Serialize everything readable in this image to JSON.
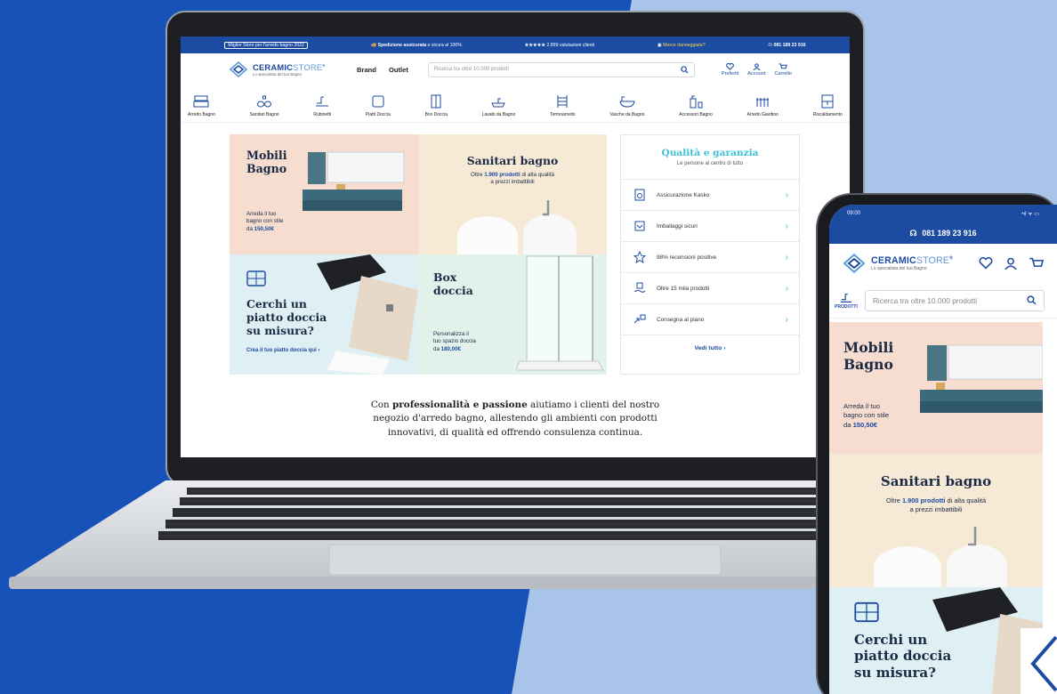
{
  "colors": {
    "brand_blue": "#1c4ba2",
    "accent_teal": "#3bc0d8",
    "bg_dark": "#1752b8",
    "bg_light": "#a8c4e8"
  },
  "topbar": {
    "best_store": "Miglior Store per l'arredo bagno 2022",
    "shipping_bold": "Spedizione assicurata",
    "shipping_rest": "e sicura al 100%",
    "stars": "★★★★★",
    "reviews": "2.899 valutazioni clienti",
    "damaged": "Merce danneggiata?",
    "phone": "081 189 23 916"
  },
  "header": {
    "brand_main": "CERAMIC",
    "brand_thin": "STORE",
    "brand_mark": "®",
    "tagline": "Lo specialista del tuo Bagno",
    "nav": [
      "Brand",
      "Outlet"
    ],
    "search_placeholder": "Ricerca tra oltre 10.000 prodotti",
    "icons": {
      "favorites": "Preferiti",
      "account": "Account",
      "cart": "Carrello"
    }
  },
  "categories": [
    "Arredo Bagno",
    "Sanitari Bagno",
    "Rubinetti",
    "Piatti Doccia",
    "Box Doccia",
    "Lavabi da Bagno",
    "Termoarredo",
    "Vasche da Bagno",
    "Accessori Bagno",
    "Arredo Giardino",
    "Riscaldamento"
  ],
  "tiles": {
    "mobili": {
      "title_1": "Mobili",
      "title_2": "Bagno",
      "text_1": "Arreda il tuo",
      "text_2": "bagno con stile",
      "text_3": "da",
      "price": "150,50€"
    },
    "sanitari": {
      "title": "Sanitari bagno",
      "pre": "Oltre",
      "count": "1.900 prodotti",
      "post": "di alta qualità",
      "line2": "a prezzi imbattibili"
    },
    "piatto": {
      "title_1": "Cerchi un",
      "title_2": "piatto doccia",
      "title_3": "su misura?",
      "link": "Crea il tuo piatto doccia qui ›"
    },
    "box": {
      "title_1": "Box",
      "title_2": "doccia",
      "text_1": "Personalizza il",
      "text_2": "tuo spazio doccia",
      "text_3": "da",
      "price": "180,00€"
    }
  },
  "quality": {
    "title": "Qualità e garanzia",
    "subtitle": "Le persone al centro di tutto",
    "items": [
      "Assicurazione Kasko",
      "Imballaggi sicuri",
      "98% recensioni positive",
      "Oltre 15 mila prodotti",
      "Consegna al piano"
    ],
    "more": "Vedi tutto ›"
  },
  "about": {
    "pre": "Con",
    "bold": "professionalità e passione",
    "line1_rest": "aiutiamo i clienti del nostro",
    "line2": "negozio d'arredo bagno, allestendo gli ambienti con prodotti",
    "line3": "innovativi, di qualità ed offrendo consulenza continua."
  },
  "phone": {
    "time": "09:00",
    "signal": "•ıl ᯤ ▭",
    "phone_number": "081 189 23 916",
    "products_label": "PRODOTTI",
    "search_placeholder": "Ricerca tra oltre 10.000 prodotti"
  }
}
